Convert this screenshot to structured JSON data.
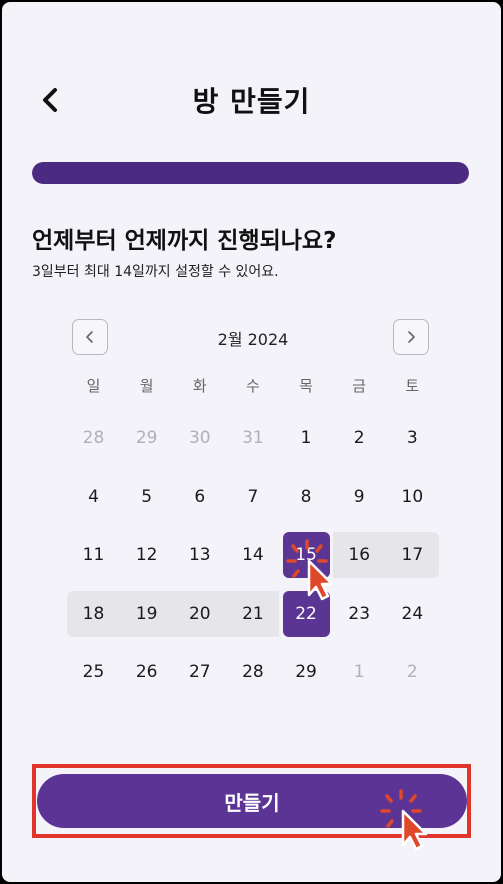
{
  "header": {
    "title": "방 만들기",
    "back_icon": "chevron-left-icon"
  },
  "progress": {
    "fraction": 1.0,
    "color": "#4b2a82"
  },
  "question": {
    "title": "언제부터 언제까지 진행되나요?",
    "subtitle": "3일부터 최대 14일까지 설정할 수 있어요."
  },
  "calendar": {
    "month_label": "2월 2024",
    "prev_icon": "chevron-left-icon",
    "next_icon": "chevron-right-icon",
    "weekdays": [
      "일",
      "월",
      "화",
      "수",
      "목",
      "금",
      "토"
    ],
    "weeks": [
      [
        "28",
        "29",
        "30",
        "31",
        "1",
        "2",
        "3"
      ],
      [
        "4",
        "5",
        "6",
        "7",
        "8",
        "9",
        "10"
      ],
      [
        "11",
        "12",
        "13",
        "14",
        "15",
        "16",
        "17"
      ],
      [
        "18",
        "19",
        "20",
        "21",
        "22",
        "23",
        "24"
      ],
      [
        "25",
        "26",
        "27",
        "28",
        "29",
        "1",
        "2"
      ]
    ],
    "range_start": "15",
    "range_end": "22",
    "selected_color": "#5a3593",
    "range_color": "#e6e6ea"
  },
  "cta": {
    "label": "만들기",
    "color": "#5b3496",
    "highlight_color": "#e0352b"
  },
  "cursors": [
    "click-cursor-icon",
    "click-cursor-icon"
  ]
}
